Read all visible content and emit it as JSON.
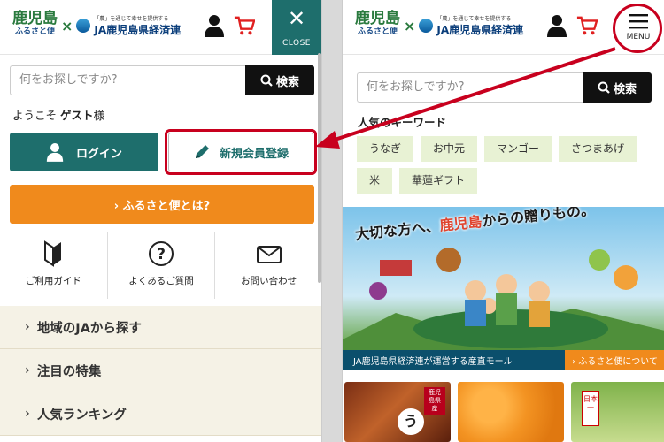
{
  "header": {
    "logo_kagoshima": "鹿児島",
    "logo_furusato": "ふるさと便",
    "logo_x": "×",
    "logo_ja_tagline": "「農」を通じて幸せを提供する",
    "logo_ja_name": "JA鹿児島県経済連",
    "close_label": "CLOSE",
    "menu_label": "MENU"
  },
  "search": {
    "placeholder_left": "何をお探しですか?",
    "placeholder_right": "何をお探しですか?",
    "button_label": "検索"
  },
  "menu": {
    "welcome_prefix": "ようこそ ",
    "welcome_name": "ゲスト",
    "welcome_suffix": "様",
    "login_label": "ログイン",
    "register_label": "新規会員登録",
    "furusato_label": "› ふるさと便とは?",
    "quick_links": [
      {
        "label": "ご利用ガイド",
        "icon": "beginner-mark-icon"
      },
      {
        "label": "よくあるご質問",
        "icon": "question-icon"
      },
      {
        "label": "お問い合わせ",
        "icon": "mail-icon"
      }
    ],
    "sections": [
      "地域のJAから探す",
      "注目の特集",
      "人気ランキング"
    ]
  },
  "keywords": {
    "title": "人気のキーワード",
    "items": [
      "うなぎ",
      "お中元",
      "マンゴー",
      "さつまあげ",
      "米",
      "華蓮ギフト"
    ]
  },
  "banner": {
    "tagline_a": "大切な方へ、",
    "tagline_b": "鹿児島",
    "tagline_c": "からの贈りもの。",
    "footer_text": "JA鹿児島県経済連が運営する産直モール",
    "more_label": "› ふるさと便について"
  },
  "thumbs": {
    "t1_label": "鹿児島県産",
    "t1_big": "う",
    "t3_label": "日本一"
  },
  "colors": {
    "teal": "#1e6e6c",
    "orange": "#f08a1c",
    "highlight_red": "#c8001e",
    "cart_red": "#e02020",
    "chip_bg": "#e8f2d4",
    "menu_list_bg": "#f5f2e6"
  }
}
